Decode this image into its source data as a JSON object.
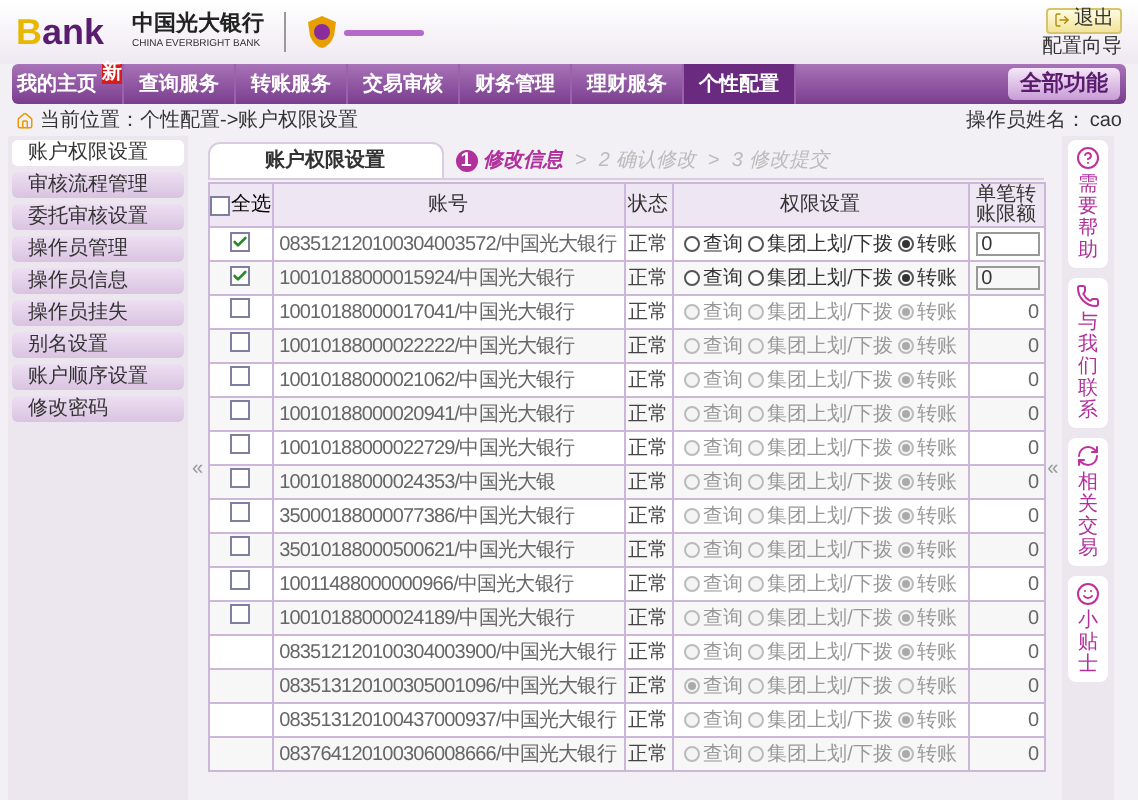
{
  "header": {
    "logo": "Bank",
    "bank_name": "中国光大银行",
    "bank_name_en": "CHINA EVERBRIGHT BANK",
    "logout": "退出",
    "wizard": "配置向导"
  },
  "nav": {
    "tabs": [
      {
        "label": "我的主页",
        "selected": false,
        "badge": "新"
      },
      {
        "label": "查询服务",
        "selected": false
      },
      {
        "label": "转账服务",
        "selected": false
      },
      {
        "label": "交易审核",
        "selected": false
      },
      {
        "label": "财务管理",
        "selected": false
      },
      {
        "label": "理财服务",
        "selected": false
      },
      {
        "label": "个性配置",
        "selected": true
      }
    ],
    "all_functions": "全部功能"
  },
  "breadcrumb": {
    "label": "当前位置：个性配置->账户权限设置",
    "operator_label": "操作员姓名：",
    "operator": "cao"
  },
  "sidebar": {
    "items": [
      {
        "label": "账户权限设置",
        "selected": true
      },
      {
        "label": "审核流程管理",
        "selected": false
      },
      {
        "label": "委托审核设置",
        "selected": false
      },
      {
        "label": "操作员管理",
        "selected": false
      },
      {
        "label": "操作员信息",
        "selected": false
      },
      {
        "label": "操作员挂失",
        "selected": false
      },
      {
        "label": "别名设置",
        "selected": false
      },
      {
        "label": "账户顺序设置",
        "selected": false
      },
      {
        "label": "修改密码",
        "selected": false
      }
    ],
    "collapse": "«"
  },
  "page_tab": "账户权限设置",
  "steps": [
    {
      "number": "1",
      "label": "修改信息",
      "selected": true
    },
    {
      "number": "2",
      "label": "确认修改",
      "selected": false
    },
    {
      "number": "3",
      "label": "修改提交",
      "selected": false
    }
  ],
  "step_separators": [
    ">",
    ">"
  ],
  "table": {
    "select_all": {
      "label": "全选",
      "checked": false
    },
    "columns": [
      "账号",
      "状态",
      "权限设置",
      "单笔转账限额"
    ],
    "rows": [
      {
        "kind": "checkbox",
        "checked": true,
        "editable": true,
        "account": "083512120100304003572/中国光大银行",
        "status": "正常",
        "options": [
          {
            "label": "查询",
            "selected": false
          },
          {
            "label": "集团上划/下拨",
            "selected": false
          },
          {
            "label": "转账",
            "selected": true
          }
        ],
        "limit": "0"
      },
      {
        "kind": "checkbox",
        "checked": true,
        "editable": true,
        "account": "10010188000015924/中国光大银行",
        "status": "正常",
        "options": [
          {
            "label": "查询",
            "selected": false
          },
          {
            "label": "集团上划/下拨",
            "selected": false
          },
          {
            "label": "转账",
            "selected": true
          }
        ],
        "limit": "0"
      },
      {
        "kind": "checkbox",
        "checked": false,
        "editable": false,
        "account": "10010188000017041/中国光大银行",
        "status": "正常",
        "options": [
          {
            "label": "查询",
            "selected": false
          },
          {
            "label": "集团上划/下拨",
            "selected": false
          },
          {
            "label": "转账",
            "selected": true
          }
        ],
        "limit": "0"
      },
      {
        "kind": "checkbox",
        "checked": false,
        "editable": false,
        "account": "10010188000022222/中国光大银行",
        "status": "正常",
        "options": [
          {
            "label": "查询",
            "selected": false
          },
          {
            "label": "集团上划/下拨",
            "selected": false
          },
          {
            "label": "转账",
            "selected": true
          }
        ],
        "limit": "0"
      },
      {
        "kind": "checkbox",
        "checked": false,
        "editable": false,
        "account": "10010188000021062/中国光大银行",
        "status": "正常",
        "options": [
          {
            "label": "查询",
            "selected": false
          },
          {
            "label": "集团上划/下拨",
            "selected": false
          },
          {
            "label": "转账",
            "selected": true
          }
        ],
        "limit": "0"
      },
      {
        "kind": "checkbox",
        "checked": false,
        "editable": false,
        "account": "10010188000020941/中国光大银行",
        "status": "正常",
        "options": [
          {
            "label": "查询",
            "selected": false
          },
          {
            "label": "集团上划/下拨",
            "selected": false
          },
          {
            "label": "转账",
            "selected": true
          }
        ],
        "limit": "0"
      },
      {
        "kind": "checkbox",
        "checked": false,
        "editable": false,
        "account": "10010188000022729/中国光大银行",
        "status": "正常",
        "options": [
          {
            "label": "查询",
            "selected": false
          },
          {
            "label": "集团上划/下拨",
            "selected": false
          },
          {
            "label": "转账",
            "selected": true
          }
        ],
        "limit": "0"
      },
      {
        "kind": "checkbox",
        "checked": false,
        "editable": false,
        "account": "10010188000024353/中国光大银",
        "status": "正常",
        "options": [
          {
            "label": "查询",
            "selected": false
          },
          {
            "label": "集团上划/下拨",
            "selected": false
          },
          {
            "label": "转账",
            "selected": true
          }
        ],
        "limit": "0"
      },
      {
        "kind": "checkbox",
        "checked": false,
        "editable": false,
        "account": "35000188000077386/中国光大银行",
        "status": "正常",
        "options": [
          {
            "label": "查询",
            "selected": false
          },
          {
            "label": "集团上划/下拨",
            "selected": false
          },
          {
            "label": "转账",
            "selected": true
          }
        ],
        "limit": "0"
      },
      {
        "kind": "checkbox",
        "checked": false,
        "editable": false,
        "account": "35010188000500621/中国光大银行",
        "status": "正常",
        "options": [
          {
            "label": "查询",
            "selected": false
          },
          {
            "label": "集团上划/下拨",
            "selected": false
          },
          {
            "label": "转账",
            "selected": true
          }
        ],
        "limit": "0"
      },
      {
        "kind": "checkbox",
        "checked": false,
        "editable": false,
        "account": "10011488000000966/中国光大银行",
        "status": "正常",
        "options": [
          {
            "label": "查询",
            "selected": false
          },
          {
            "label": "集团上划/下拨",
            "selected": false
          },
          {
            "label": "转账",
            "selected": true
          }
        ],
        "limit": "0"
      },
      {
        "kind": "checkbox",
        "checked": false,
        "editable": false,
        "account": "10010188000024189/中国光大银行",
        "status": "正常",
        "options": [
          {
            "label": "查询",
            "selected": false
          },
          {
            "label": "集团上划/下拨",
            "selected": false
          },
          {
            "label": "转账",
            "selected": true
          }
        ],
        "limit": "0"
      },
      {
        "kind": "plain",
        "editable": false,
        "account": "083512120100304003900/中国光大银行",
        "status": "正常",
        "options": [
          {
            "label": "查询",
            "selected": false
          },
          {
            "label": "集团上划/下拨",
            "selected": false
          },
          {
            "label": "转账",
            "selected": true
          }
        ],
        "limit": "0"
      },
      {
        "kind": "plain",
        "editable": false,
        "account": "083513120100305001096/中国光大银行",
        "status": "正常",
        "options": [
          {
            "label": "查询",
            "selected": true
          },
          {
            "label": "集团上划/下拨",
            "selected": false
          },
          {
            "label": "转账",
            "selected": false
          }
        ],
        "limit": "0"
      },
      {
        "kind": "plain",
        "editable": false,
        "account": "083513120100437000937/中国光大银行",
        "status": "正常",
        "options": [
          {
            "label": "查询",
            "selected": false
          },
          {
            "label": "集团上划/下拨",
            "selected": false
          },
          {
            "label": "转账",
            "selected": true
          }
        ],
        "limit": "0"
      },
      {
        "kind": "plain",
        "editable": false,
        "account": "083764120100306008666/中国光大银行",
        "status": "正常",
        "options": [
          {
            "label": "查询",
            "selected": false
          },
          {
            "label": "集团上划/下拨",
            "selected": false
          },
          {
            "label": "转账",
            "selected": true
          }
        ],
        "limit": "0"
      }
    ]
  },
  "right_panel": {
    "collapse": "«",
    "items": [
      {
        "kind": "help",
        "label": "需要帮助"
      },
      {
        "kind": "contact",
        "label": "与我们联系"
      },
      {
        "kind": "related",
        "label": "相关交易"
      },
      {
        "kind": "tips",
        "label": "小贴士"
      }
    ]
  }
}
